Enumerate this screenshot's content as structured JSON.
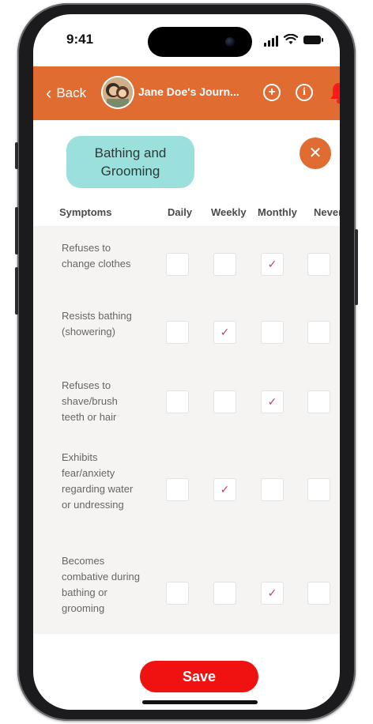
{
  "status_bar": {
    "time": "9:41"
  },
  "header": {
    "back_label": "Back",
    "title": "Jane Doe's Journ...",
    "background_color": "#e06c32"
  },
  "category": {
    "label": "Bathing and Grooming",
    "pill_color": "#9be0dc",
    "close_symbol": "✕"
  },
  "columns": [
    "Symptoms",
    "Daily",
    "Weekly",
    "Monthly",
    "Never"
  ],
  "check_mark": "✓",
  "check_color": "#d43a5a",
  "rows": [
    {
      "label": "Refuses to change clothes",
      "checked": "Monthly"
    },
    {
      "label": "Resists bathing (showering)",
      "checked": "Weekly"
    },
    {
      "label": "Refuses to shave/brush teeth or hair",
      "checked": "Monthly"
    },
    {
      "label": "Exhibits fear/anxiety regarding water or undressing",
      "checked": "Weekly"
    },
    {
      "label": "Becomes combative during bathing or grooming",
      "checked": "Monthly"
    }
  ],
  "save_label": "Save",
  "save_color": "#f01111",
  "icons": {
    "back": "chevron-left-icon",
    "add": "plus-circle-icon",
    "info": "info-circle-icon",
    "notifications": "bell-icon",
    "close": "close-icon"
  }
}
